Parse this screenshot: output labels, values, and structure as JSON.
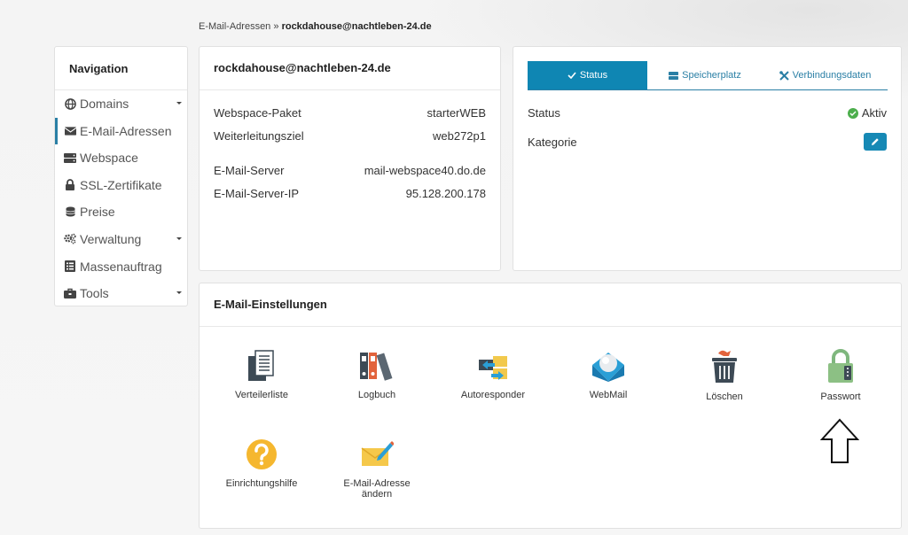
{
  "breadcrumb": {
    "parent": "E-Mail-Adressen",
    "separator": "»",
    "current": "rockdahouse@nachtleben-24.de"
  },
  "navigation": {
    "title": "Navigation",
    "items": [
      {
        "label": "Domains",
        "icon": "globe-icon",
        "has_submenu": true
      },
      {
        "label": "E-Mail-Adressen",
        "icon": "envelope-icon",
        "active": true
      },
      {
        "label": "Webspace",
        "icon": "server-icon"
      },
      {
        "label": "SSL-Zertifikate",
        "icon": "lock-icon"
      },
      {
        "label": "Preise",
        "icon": "coins-icon"
      },
      {
        "label": "Verwaltung",
        "icon": "gears-icon",
        "has_submenu": true
      },
      {
        "label": "Massenauftrag",
        "icon": "list-icon"
      },
      {
        "label": "Tools",
        "icon": "toolbox-icon",
        "has_submenu": true
      }
    ]
  },
  "account": {
    "title": "rockdahouse@nachtleben-24.de",
    "rows": [
      {
        "label": "Webspace-Paket",
        "value": "starterWEB"
      },
      {
        "label": "Weiterleitungsziel",
        "value": "web272p1"
      },
      {
        "label": "E-Mail-Server",
        "value": "mail-webspace40.do.de"
      },
      {
        "label": "E-Mail-Server-IP",
        "value": "95.128.200.178"
      }
    ]
  },
  "status_panel": {
    "tabs": [
      {
        "label": "Status",
        "icon": "check-icon",
        "active": true
      },
      {
        "label": "Speicherplatz",
        "icon": "hdd-icon"
      },
      {
        "label": "Verbindungsdaten",
        "icon": "tools-icon"
      }
    ],
    "status_label": "Status",
    "status_value": "Aktiv",
    "kategorie_label": "Kategorie"
  },
  "settings": {
    "title": "E-Mail-Einstellungen",
    "tiles": [
      {
        "label": "Verteilerliste",
        "icon": "distribution-list-icon"
      },
      {
        "label": "Logbuch",
        "icon": "binders-icon"
      },
      {
        "label": "Autoresponder",
        "icon": "autoresponder-icon"
      },
      {
        "label": "WebMail",
        "icon": "webmail-icon"
      },
      {
        "label": "Löschen",
        "icon": "trash-icon"
      },
      {
        "label": "Passwort",
        "icon": "padlock-icon"
      },
      {
        "label": "Einrichtungshilfe",
        "icon": "help-icon"
      },
      {
        "label": "E-Mail-Adresse ändern",
        "label_line1": "E-Mail-Adresse",
        "label_line2": "ändern",
        "icon": "edit-envelope-icon"
      }
    ]
  },
  "colors": {
    "accent": "#0f86b3",
    "active_border": "#2a7fa5",
    "ok_green": "#4cae4c"
  }
}
